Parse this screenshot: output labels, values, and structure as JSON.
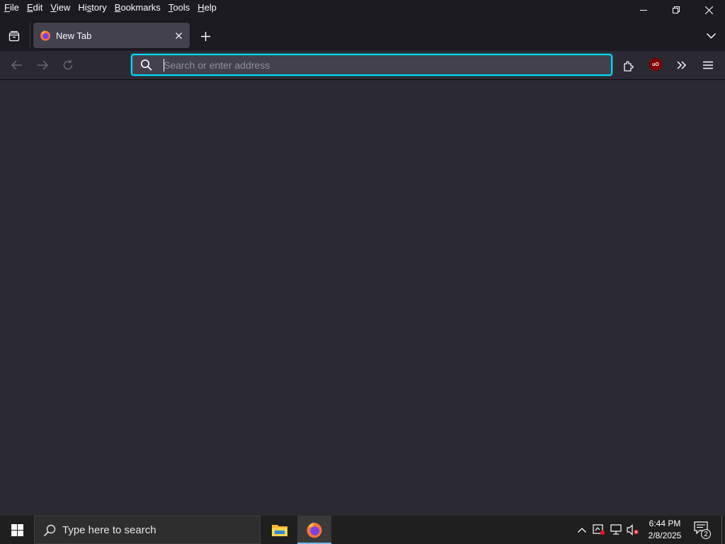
{
  "menu": {
    "items": [
      {
        "first": "F",
        "rest": "ile"
      },
      {
        "first": "E",
        "rest": "dit"
      },
      {
        "first": "V",
        "rest": "iew"
      },
      {
        "first": "",
        "pre": "Hi",
        "ul": "s",
        "rest": "tory"
      },
      {
        "first": "B",
        "rest": "ookmarks"
      },
      {
        "first": "T",
        "rest": "ools"
      },
      {
        "first": "H",
        "rest": "elp"
      }
    ]
  },
  "tabs": [
    {
      "title": "New Tab",
      "favicon": "firefox-icon",
      "active": true
    }
  ],
  "urlbar": {
    "placeholder": "Search or enter address",
    "value": ""
  },
  "toolbar_icons": [
    "extensions-icon",
    "ublock-origin-icon",
    "overflow-chevrons-icon",
    "hamburger-menu-icon"
  ],
  "ublock": {
    "label": "uO"
  },
  "taskbar": {
    "search_placeholder": "Type here to search",
    "apps": [
      "file-explorer-icon",
      "firefox-icon"
    ],
    "clock": {
      "time": "6:44 PM",
      "date": "2/8/2025"
    },
    "notifications_count": "2"
  },
  "colors": {
    "accent": "#00ddff",
    "chrome_bg": "#1c1b22",
    "toolbar_bg": "#2b2a33",
    "tab_active_bg": "#42414d",
    "taskbar_bg": "#1f1f1f",
    "taskbar_indicator": "#76b9ed"
  }
}
